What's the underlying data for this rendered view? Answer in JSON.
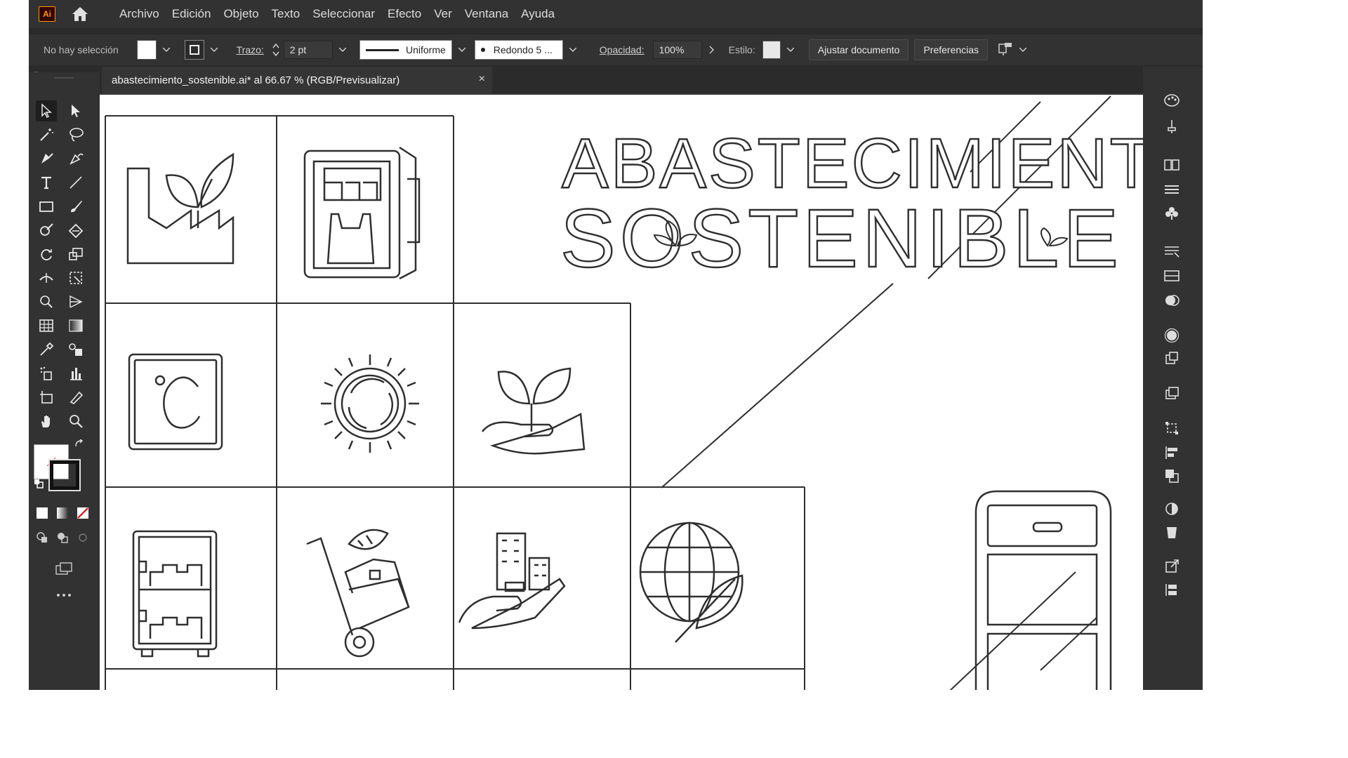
{
  "app": {
    "logo": "Ai"
  },
  "menu": [
    "Archivo",
    "Edición",
    "Objeto",
    "Texto",
    "Seleccionar",
    "Efecto",
    "Ver",
    "Ventana",
    "Ayuda"
  ],
  "control": {
    "selection": "No hay selección",
    "stroke_label": "Trazo:",
    "stroke_value": "2 pt",
    "profile": "Uniforme",
    "brush": "Redondo 5 ...",
    "opacity_label": "Opacidad:",
    "opacity_value": "100%",
    "style_label": "Estilo:",
    "fit_button": "Ajustar documento",
    "prefs_button": "Preferencias"
  },
  "document": {
    "tab_title": "abastecimiento_sostenible.ai* al 66.67 % (RGB/Previsualizar)",
    "close": "×"
  },
  "artwork": {
    "title_line1": "ABASTECIMIENTO",
    "title_line2": "SOSTENIBLE"
  },
  "icons": {
    "grid": [
      "factory-leaf-icon",
      "vending-machine-icon",
      "celsius-icon",
      "sun-recycle-icon",
      "hand-plant-icon",
      "cabinet-icon",
      "hand-truck-icon",
      "hand-city-icon",
      "globe-leaf-icon",
      "phone-icon"
    ],
    "colors": {
      "ui_bg": "#2b2b2b",
      "panel": "#323232",
      "artboard": "#ffffff",
      "line": "#333333",
      "accent": "#ff9a00"
    }
  }
}
